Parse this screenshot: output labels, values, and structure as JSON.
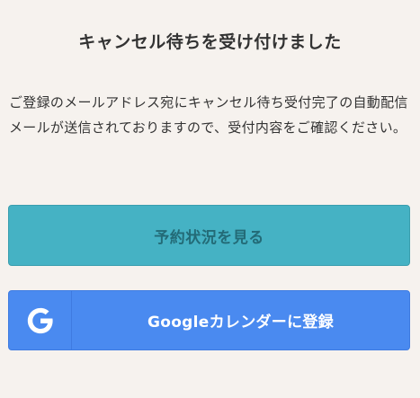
{
  "title": "キャンセル待ちを受け付けました",
  "message": "ご登録のメールアドレス宛にキャンセル待ち受付完了の自動配信メールが送信されておりますので、受付内容をご確認ください。",
  "buttons": {
    "reservation_label": "予約状況を見る",
    "google_calendar_label": "Googleカレンダーに登録"
  },
  "colors": {
    "background": "#f6f2ee",
    "reservation_button": "#45b2c4",
    "reservation_label": "#236b77",
    "google_button": "#4a8af0"
  },
  "icons": {
    "google": "google-g-icon"
  }
}
